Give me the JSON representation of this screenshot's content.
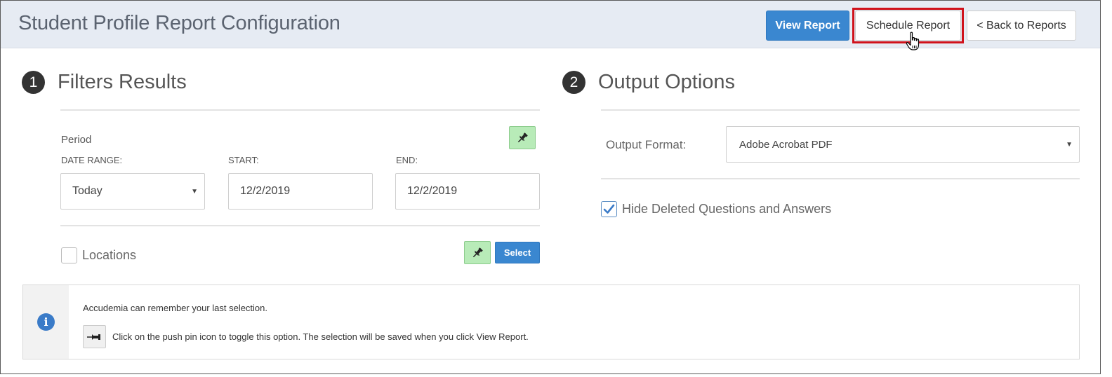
{
  "header": {
    "title": "Student Profile Report Configuration",
    "view_report": "View Report",
    "schedule_report": "Schedule Report",
    "back_to_reports": "< Back to Reports"
  },
  "filters": {
    "step": "1",
    "title": "Filters Results",
    "period_label": "Period",
    "date_range_label": "DATE RANGE:",
    "start_label": "START:",
    "end_label": "END:",
    "date_range_value": "Today",
    "start_value": "12/2/2019",
    "end_value": "12/2/2019",
    "locations_label": "Locations",
    "select_label": "Select"
  },
  "output": {
    "step": "2",
    "title": "Output Options",
    "format_label": "Output Format:",
    "format_value": "Adobe Acrobat PDF",
    "hide_deleted_label": "Hide Deleted Questions and Answers",
    "hide_deleted_checked": true
  },
  "info": {
    "line1": "Accudemia can remember your last selection.",
    "line2": "Click on the push pin icon to toggle this option. The selection will be saved when you click View Report."
  },
  "colors": {
    "primary": "#3a87d0",
    "highlight": "#d0121b",
    "pin_active": "#b8ebb8",
    "header_bg": "#e6ebf3"
  }
}
